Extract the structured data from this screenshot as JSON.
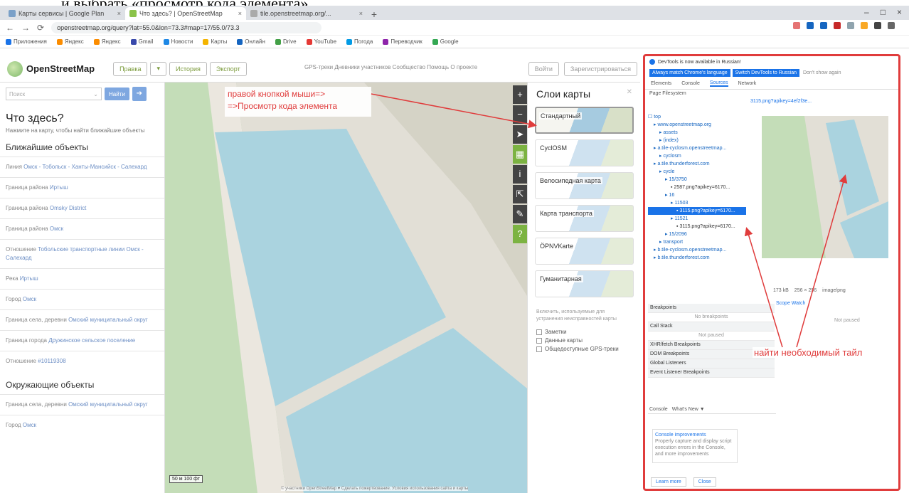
{
  "caption": "и выбрать «просмотр кода элемента»",
  "browser": {
    "tabs": [
      {
        "label": "Карты сервисы | Google Plan"
      },
      {
        "label": "Что здесь? | OpenStreetMap"
      },
      {
        "label": "tile.openstreetmap.org/..."
      }
    ],
    "url": "openstreetmap.org/query?lat=55.0&lon=73.3#map=17/55.0/73.3",
    "bookmarks": [
      "Приложения",
      "Яндекс",
      "Яндекс",
      "Gmail",
      "Новости",
      "Карты",
      "Онлайн",
      "Drive",
      "YouTube",
      "Погода",
      "Переводчик",
      "Google"
    ]
  },
  "osm": {
    "logo": "OpenStreetMap",
    "header_buttons": [
      "Правка",
      "История",
      "Экспорт"
    ],
    "header_links": "GPS-треки Дневники участников Сообщество Помощь О проекте",
    "login_buttons": [
      "Войти",
      "Зарегистрироваться"
    ],
    "search_placeholder": "Поиск",
    "search_go": "Найти",
    "directions_icon": "directions-icon"
  },
  "sidebar": {
    "title": "Что здесь?",
    "subtitle": "Нажмите на карту, чтобы найти ближайшие объекты",
    "nearby_title": "Ближайшие объекты",
    "nearby": [
      {
        "type": "Линия",
        "name": "Омск - Тобольск - Ханты-Мансийск - Салехард"
      },
      {
        "type": "Граница района",
        "name": "Иртыш"
      },
      {
        "type": "Граница района",
        "name": "Omsky District"
      },
      {
        "type": "Граница района",
        "name": "Омск"
      },
      {
        "type": "Отношение",
        "name": "Тобольские транспортные линии Омск - Салехард"
      },
      {
        "type": "Река",
        "name": "Иртыш"
      },
      {
        "type": "Город",
        "name": "Омск"
      },
      {
        "type": "Граница села, деревни",
        "name": "Омский муниципальный округ"
      },
      {
        "type": "Граница города",
        "name": "Дружинское сельское поселение"
      },
      {
        "type": "Отношение",
        "name": "#10119308"
      }
    ],
    "enclosing_title": "Окружающие объекты",
    "enclosing": [
      {
        "type": "Граница села, деревни",
        "name": "Омский муниципальный округ"
      },
      {
        "type": "Город",
        "name": "Омск"
      }
    ]
  },
  "map": {
    "annotation": "правой кнопкой мыши=> =>Просмотр кода элемента",
    "scale": "50 м\n100 фт",
    "attribution": "© участники OpenStreetMap ♥ Сделать пожертвование. Условия использования сайта и карты"
  },
  "layers": {
    "title": "Слои карты",
    "items": [
      "Стандартный",
      "CyclOSM",
      "Велосипедная карта",
      "Карта транспорта",
      "ÖPNVKarte",
      "Гуманитарная"
    ],
    "selected": 0,
    "note": "Включить, используемые для устранения неисправностей карты",
    "overlays": [
      "Заметки",
      "Данные карты",
      "Общедоступные GPS-треки"
    ]
  },
  "devtools": {
    "info": "DevTools is now available in Russian!",
    "btn1": "Always match Chrome's language",
    "btn2": "Switch DevTools to Russian",
    "btn3": "Don't show again",
    "tabs": [
      "Elements",
      "Console",
      "Sources",
      "Network"
    ],
    "active_tab": "Sources",
    "subtabs": "Page  Filesystem",
    "file_tab": "3115.png?apikey=4ef2f3e...",
    "tree": [
      "top",
      "www.openstreetmap.org",
      "assets",
      "(index)",
      "a.tile-cyclosm.openstreetmap...",
      "cyclosm",
      "a.tile.thunderforest.com",
      "cycle",
      "15/3750",
      "2587.png?apikey=6170...",
      "16",
      "11503",
      "3115.png?apikey=6170...",
      "11521",
      "3115.png?apikey=6170...",
      "15/2096",
      "transport",
      "b.tile-cyclosm.openstreetmap...",
      "b.tile.thunderforest.com"
    ],
    "lower": [
      "Breakpoints",
      "No breakpoints",
      "Call Stack",
      "Not paused",
      "XHR/fetch Breakpoints",
      "DOM Breakpoints",
      "Global Listeners",
      "Event Listener Breakpoints"
    ],
    "right_info": [
      "173 kB",
      "256 × 256",
      "image/png"
    ],
    "scope_tabs": "Scope  Watch",
    "not_paused": "Not paused",
    "console_tabs": [
      "Console",
      "What's New ▼"
    ],
    "console_title": "Console improvements",
    "console_text": "Properly capture and display script execution errors in the Console, and more improvements",
    "footer": [
      "Learn more",
      "Close"
    ],
    "annotation": "найти необходимый тайл"
  }
}
